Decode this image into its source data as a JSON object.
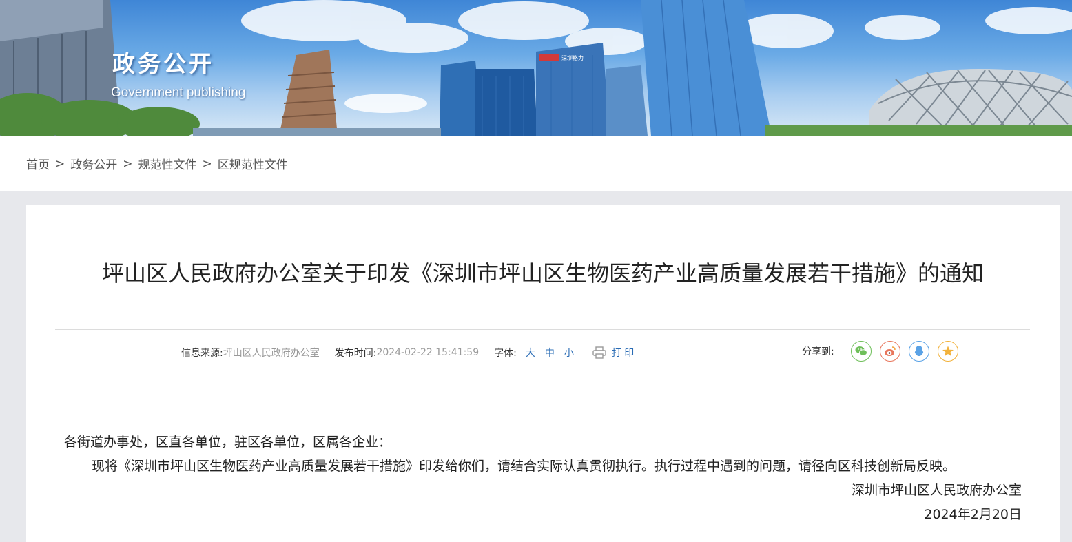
{
  "banner": {
    "title": "政务公开",
    "subtitle": "Government publishing",
    "building_sign": "深圳格力"
  },
  "breadcrumb": {
    "items": [
      "首页",
      "政务公开",
      "规范性文件",
      "区规范性文件"
    ],
    "separator": ">"
  },
  "article": {
    "title": "坪山区人民政府办公室关于印发《深圳市坪山区生物医药产业高质量发展若干措施》的通知",
    "meta": {
      "source_label": "信息来源:",
      "source_value": "坪山区人民政府办公室",
      "date_label": "发布时间:",
      "date_value": "2024-02-22 15:41:59",
      "font_label": "字体:",
      "font_sizes": [
        "大",
        "中",
        "小"
      ],
      "print_label": "打 印"
    },
    "share": {
      "label": "分享到:",
      "targets": [
        "wechat-icon",
        "weibo-icon",
        "qq-icon",
        "qzone-icon"
      ]
    },
    "body": {
      "salutation": "各街道办事处，区直各单位，驻区各单位，区属各企业：",
      "paragraph": "现将《深圳市坪山区生物医药产业高质量发展若干措施》印发给你们，请结合实际认真贯彻执行。执行过程中遇到的问题，请径向区科技创新局反映。",
      "signature": "深圳市坪山区人民政府办公室",
      "date": "2024年2月20日"
    }
  },
  "colors": {
    "link_blue": "#2a6cb5",
    "wechat": "#6fbf5a",
    "weibo": "#e8765c",
    "qq": "#5aa2e6",
    "favorite": "#f2b23c"
  }
}
